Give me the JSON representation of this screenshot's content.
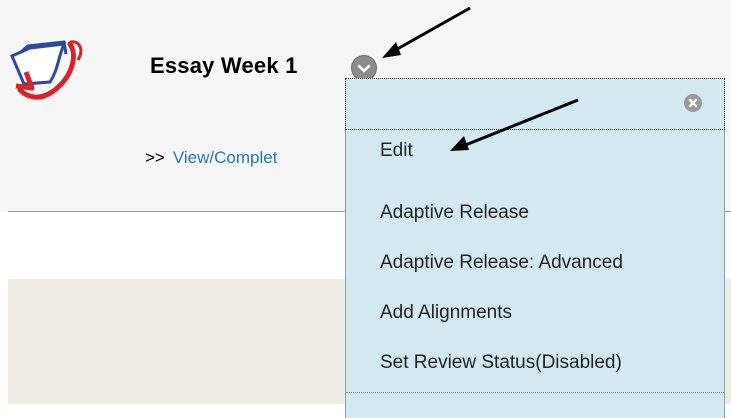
{
  "item": {
    "title": "Essay Week 1",
    "link_prefix": ">>",
    "link_text": "View/Complet"
  },
  "context_menu": {
    "items": [
      {
        "label": "Edit"
      },
      {
        "label": "Adaptive Release"
      },
      {
        "label": "Adaptive Release: Advanced"
      },
      {
        "label": "Add Alignments"
      },
      {
        "label": "Set Review Status(Disabled)"
      }
    ]
  },
  "icons": {
    "tool_icon": "turnitin-assignment-icon",
    "menu_trigger": "chevron-down-icon",
    "menu_close": "close-icon"
  },
  "colors": {
    "menu_background": "#d3e9ef",
    "link": "#2a7ba8",
    "icon_red": "#d8232a"
  }
}
